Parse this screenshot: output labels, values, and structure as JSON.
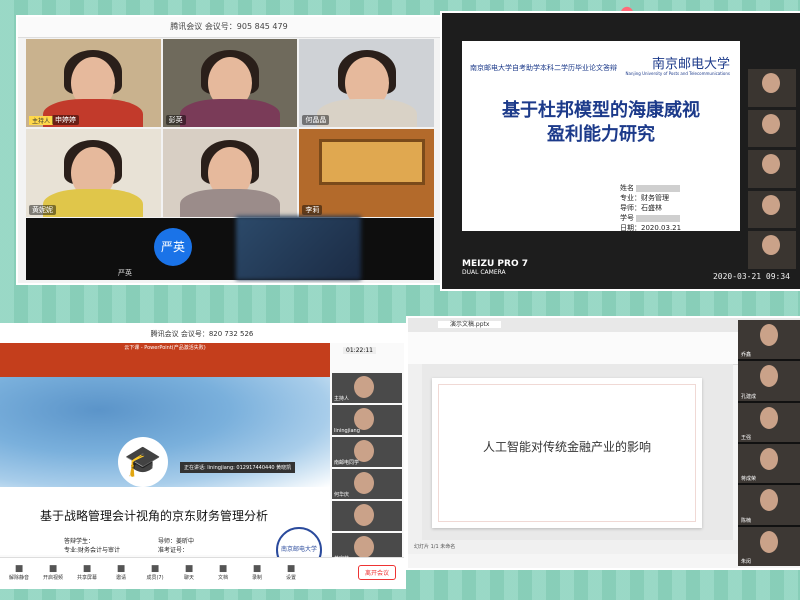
{
  "colors": {
    "background": "#8fd3bf",
    "tencent_blue": "#1a73e8",
    "ppt_red": "#c43e1c",
    "slide_navy": "#1c3a8a"
  },
  "panel_a": {
    "app": "腾讯会议",
    "meeting_id": "会议号：905 845 479",
    "tiles": [
      {
        "name": "申婷婷",
        "role": "主持人"
      },
      {
        "name": "彭英"
      },
      {
        "name": "何晶晶"
      },
      {
        "name": "黄妮妮"
      },
      {
        "name": ""
      },
      {
        "name": "李莉"
      }
    ],
    "bottom_avatar": "严英",
    "bottom_name": "严英"
  },
  "panel_b": {
    "header": "南京邮电大学自考助学本科二学历毕业论文答辩",
    "logo": "南京邮电大学",
    "logo_sub": "Nanjing University of Posts and Telecommunications",
    "title_line1": "基于杜邦模型的海康威视",
    "title_line2": "盈利能力研究",
    "info": [
      {
        "k": "姓名",
        "v": ""
      },
      {
        "k": "专业：",
        "v": "财务管理"
      },
      {
        "k": "导师：",
        "v": "石盛林"
      },
      {
        "k": "学号",
        "v": ""
      },
      {
        "k": "日期：",
        "v": "2020.03.21"
      }
    ],
    "camera_brand": "MEIZU PRO 7",
    "camera_sub": "DUAL CAMERA",
    "stamp": "2020-03-21  09:34"
  },
  "panel_c": {
    "app": "腾讯会议",
    "meeting_id": "会议号：820 732 526",
    "ppt_title": "云下课 - PowerPoint(产品激活失败)",
    "clock": "01:22:11",
    "speaking": "正在讲话: liningjiang: 0129174404​40 黄晓凯",
    "title": "基于战略管理会计视角的京东财务管理分析",
    "info_left": [
      "答辩学生：",
      "专业:财务会计与审计"
    ],
    "info_right": [
      "导师：姜昕中",
      "准考证号："
    ],
    "seal": "南京邮电大学",
    "side_names": [
      "主持人",
      "liningjiang",
      "南邮电同学",
      "何华庆",
      "",
      "黄宝芬"
    ],
    "toolbar": [
      "解除静音",
      "开启视频",
      "共享屏幕",
      "邀请",
      "成员(7)",
      "聊天",
      "文档",
      "录制",
      "设置"
    ],
    "leave": "离开会议"
  },
  "panel_d": {
    "tab": "演示文稿.pptx",
    "slide_title": "人工智能对传统金融产业的影响",
    "status": "幻灯片 1/1    未命名",
    "side_names": [
      "乔鑫",
      "孔建成",
      "王强",
      "蒋成荣",
      "陈楠",
      "朱闵"
    ]
  }
}
